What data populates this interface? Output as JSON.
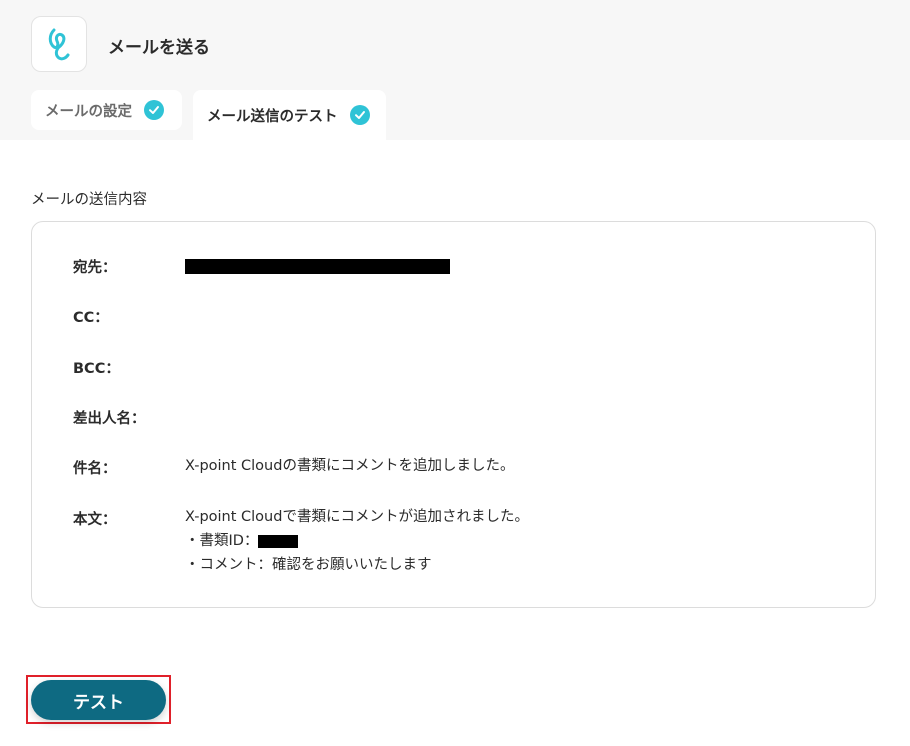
{
  "header": {
    "title": "メールを送る",
    "app_icon": "yoom-logo-icon"
  },
  "tabs": [
    {
      "label": "メールの設定",
      "completed": true
    },
    {
      "label": "メール送信のテスト",
      "completed": true,
      "active": true
    }
  ],
  "section": {
    "title": "メールの送信内容"
  },
  "fields": {
    "to": {
      "label": "宛先：",
      "value": "[redacted]"
    },
    "cc": {
      "label": "CC：",
      "value": ""
    },
    "bcc": {
      "label": "BCC：",
      "value": ""
    },
    "sender": {
      "label": "差出人名：",
      "value": ""
    },
    "subject": {
      "label": "件名：",
      "value": "X-point Cloudの書類にコメントを追加しました。"
    },
    "body": {
      "label": "本文：",
      "line1": "X-point Cloudで書類にコメントが追加されました。",
      "line2_prefix": "・書類ID：",
      "line3": "・コメント：確認をお願いいたします"
    }
  },
  "actions": {
    "test_label": "テスト"
  },
  "colors": {
    "accent_check": "#2fc3d6",
    "primary_button": "#0e6a82",
    "highlight_frame": "#e0202a"
  }
}
